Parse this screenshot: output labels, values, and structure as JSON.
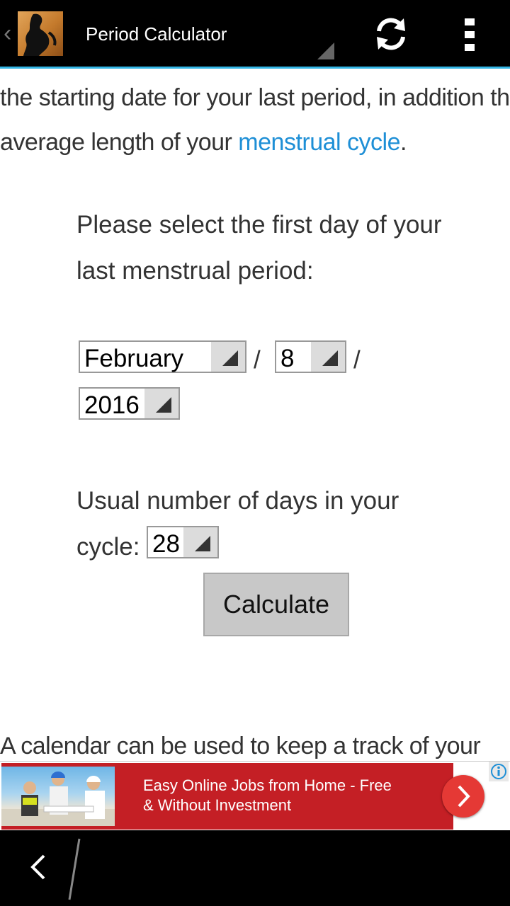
{
  "action_bar": {
    "title": "Period Calculator",
    "icons": {
      "app": "pregnant-silhouette-icon",
      "refresh": "refresh-icon",
      "overflow": "overflow-menu-icon",
      "up": "up-caret-icon"
    },
    "colors": {
      "background": "#000000",
      "accent_line": "#33b5e5"
    }
  },
  "content": {
    "intro_line1": "the starting date for your last period, in addition th",
    "intro_line2_prefix": "average length of your ",
    "intro_link": "menstrual cycle",
    "intro_line2_suffix": ".",
    "prompt_line1": "Please select the first day of your",
    "prompt_line2": "last menstrual period:",
    "date": {
      "month": "February",
      "day": "8",
      "year": "2016",
      "separator": "/"
    },
    "cycle_line1": "Usual number of days in your",
    "cycle_label": "cycle:",
    "cycle_value": "28",
    "calculate_label": "Calculate",
    "outro": "A calendar can be used to keep a track of your",
    "link_color": "#1e8fd6"
  },
  "ad": {
    "text_line1": "Easy Online Jobs from Home - Free",
    "text_line2": "& Without Investment",
    "colors": {
      "background": "#c41f25",
      "button": "#e53935"
    },
    "icons": {
      "go": "chevron-right-icon",
      "info": "info-icon"
    }
  },
  "nav_bar": {
    "icons": {
      "back": "back-chevron-icon"
    }
  }
}
